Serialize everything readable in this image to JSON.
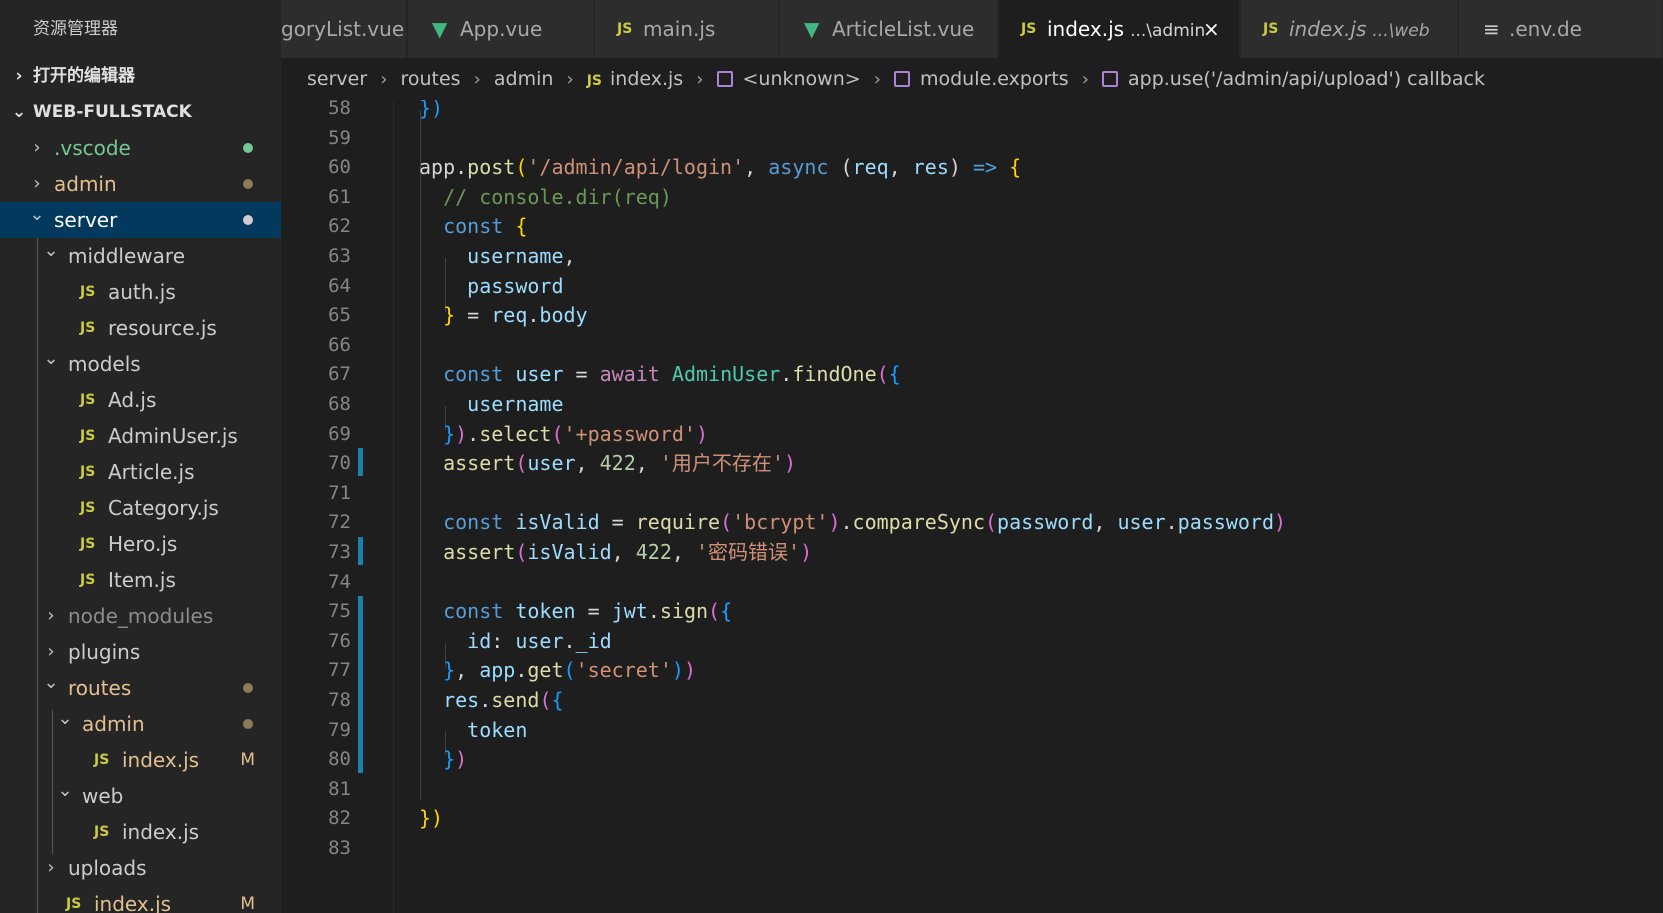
{
  "sidebar": {
    "title": "资源管理器",
    "sections": {
      "open_editors": "打开的编辑器",
      "project": "WEB-FULLSTACK"
    },
    "tree": [
      {
        "label": ".vscode",
        "color": "#73c991",
        "dot": "#73c991",
        "kind": "folder",
        "expanded": false
      },
      {
        "label": "admin",
        "color": "#e2c08d",
        "dot": "#8f7a57",
        "kind": "folder",
        "expanded": false
      },
      {
        "label": "server",
        "color": "#ffffff",
        "dot": "#cfcfcf",
        "kind": "folder",
        "expanded": true,
        "selected": true
      },
      {
        "label": "middleware",
        "color": "#cccccc",
        "kind": "folder",
        "expanded": true
      },
      {
        "label": "auth.js",
        "color": "#cccccc",
        "kind": "js"
      },
      {
        "label": "resource.js",
        "color": "#cccccc",
        "kind": "js"
      },
      {
        "label": "models",
        "color": "#cccccc",
        "kind": "folder",
        "expanded": true
      },
      {
        "label": "Ad.js",
        "color": "#cccccc",
        "kind": "js"
      },
      {
        "label": "AdminUser.js",
        "color": "#cccccc",
        "kind": "js"
      },
      {
        "label": "Article.js",
        "color": "#cccccc",
        "kind": "js"
      },
      {
        "label": "Category.js",
        "color": "#cccccc",
        "kind": "js"
      },
      {
        "label": "Hero.js",
        "color": "#cccccc",
        "kind": "js"
      },
      {
        "label": "Item.js",
        "color": "#cccccc",
        "kind": "js"
      },
      {
        "label": "node_modules",
        "color": "#8c8c8c",
        "kind": "folder",
        "expanded": false
      },
      {
        "label": "plugins",
        "color": "#cccccc",
        "kind": "folder",
        "expanded": false
      },
      {
        "label": "routes",
        "color": "#e2c08d",
        "dot": "#8f7a57",
        "kind": "folder",
        "expanded": true
      },
      {
        "label": "admin",
        "color": "#e2c08d",
        "dot": "#8f7a57",
        "kind": "folder",
        "expanded": true
      },
      {
        "label": "index.js",
        "color": "#e2c08d",
        "badge": "M",
        "kind": "js"
      },
      {
        "label": "web",
        "color": "#cccccc",
        "kind": "folder",
        "expanded": true
      },
      {
        "label": "index.js",
        "color": "#cccccc",
        "kind": "js"
      },
      {
        "label": "uploads",
        "color": "#cccccc",
        "kind": "folder",
        "expanded": false
      },
      {
        "label": "index.js",
        "color": "#e2c08d",
        "badge": "M",
        "kind": "js"
      }
    ]
  },
  "tabs": [
    {
      "label": "goryList.vue",
      "icon": "none"
    },
    {
      "label": "App.vue",
      "icon": "vue"
    },
    {
      "label": "main.js",
      "icon": "js"
    },
    {
      "label": "ArticleList.vue",
      "icon": "vue"
    },
    {
      "label": "index.js",
      "desc": "...\\admin",
      "icon": "js",
      "active": true,
      "close": "×"
    },
    {
      "label": "index.js",
      "desc": "...\\web",
      "icon": "js",
      "italic": true
    },
    {
      "label": ".env.de",
      "icon": "lines"
    }
  ],
  "icons": {
    "js": "JS",
    "chevron_right": "›",
    "chevron_down": "⌄"
  },
  "breadcrumb": [
    "server",
    "routes",
    "admin",
    "index.js",
    "<unknown>",
    "module.exports",
    "app.use('/admin/api/upload') callback"
  ],
  "editor": {
    "line_numbers": [
      "58",
      "59",
      "60",
      "61",
      "62",
      "63",
      "64",
      "65",
      "66",
      "67",
      "68",
      "69",
      "70",
      "71",
      "72",
      "73",
      "74",
      "75",
      "76",
      "77",
      "78",
      "79",
      "80",
      "81",
      "82",
      "83"
    ],
    "lines": [
      [
        [
          "})",
          "p3"
        ]
      ],
      [],
      [
        [
          "app",
          "plain"
        ],
        [
          ".",
          "plain"
        ],
        [
          "post",
          "fn"
        ],
        [
          "(",
          "p1"
        ],
        [
          "'/admin/api/login'",
          "str"
        ],
        [
          ", ",
          "plain"
        ],
        [
          "async",
          "kw"
        ],
        [
          " (",
          "plain"
        ],
        [
          "req",
          "var"
        ],
        [
          ", ",
          "plain"
        ],
        [
          "res",
          "var"
        ],
        [
          ") ",
          "plain"
        ],
        [
          "=>",
          "kw"
        ],
        [
          " {",
          "p1"
        ]
      ],
      [
        [
          "  // console.dir(req)",
          "com"
        ]
      ],
      [
        [
          "  const",
          "kw"
        ],
        [
          " {",
          "p1"
        ]
      ],
      [
        [
          "    username",
          "var"
        ],
        [
          ",",
          "plain"
        ]
      ],
      [
        [
          "    password",
          "var"
        ]
      ],
      [
        [
          "  }",
          "p1"
        ],
        [
          " = ",
          "plain"
        ],
        [
          "req",
          "var"
        ],
        [
          ".",
          "plain"
        ],
        [
          "body",
          "var"
        ]
      ],
      [],
      [
        [
          "  const",
          "kw"
        ],
        [
          " ",
          "plain"
        ],
        [
          "user",
          "var"
        ],
        [
          " = ",
          "plain"
        ],
        [
          "await",
          "ctl"
        ],
        [
          " ",
          "plain"
        ],
        [
          "AdminUser",
          "cls"
        ],
        [
          ".",
          "plain"
        ],
        [
          "findOne",
          "fn"
        ],
        [
          "(",
          "p2"
        ],
        [
          "{",
          "p3"
        ]
      ],
      [
        [
          "    username",
          "var"
        ]
      ],
      [
        [
          "  }",
          "p3"
        ],
        [
          ")",
          "p2"
        ],
        [
          ".",
          "plain"
        ],
        [
          "select",
          "fn"
        ],
        [
          "(",
          "p2"
        ],
        [
          "'+password'",
          "str"
        ],
        [
          ")",
          "p2"
        ]
      ],
      [
        [
          "  assert",
          "fn"
        ],
        [
          "(",
          "p2"
        ],
        [
          "user",
          "var"
        ],
        [
          ", ",
          "plain"
        ],
        [
          "422",
          "num"
        ],
        [
          ", ",
          "plain"
        ],
        [
          "'用户不存在'",
          "str"
        ],
        [
          ")",
          "p2"
        ]
      ],
      [],
      [
        [
          "  const",
          "kw"
        ],
        [
          " ",
          "plain"
        ],
        [
          "isValid",
          "var"
        ],
        [
          " = ",
          "plain"
        ],
        [
          "require",
          "fn"
        ],
        [
          "(",
          "p2"
        ],
        [
          "'bcrypt'",
          "str"
        ],
        [
          ")",
          "p2"
        ],
        [
          ".",
          "plain"
        ],
        [
          "compareSync",
          "fn"
        ],
        [
          "(",
          "p2"
        ],
        [
          "password",
          "var"
        ],
        [
          ", ",
          "plain"
        ],
        [
          "user",
          "var"
        ],
        [
          ".",
          "plain"
        ],
        [
          "password",
          "var"
        ],
        [
          ")",
          "p2"
        ]
      ],
      [
        [
          "  assert",
          "fn"
        ],
        [
          "(",
          "p2"
        ],
        [
          "isValid",
          "var"
        ],
        [
          ", ",
          "plain"
        ],
        [
          "422",
          "num"
        ],
        [
          ", ",
          "plain"
        ],
        [
          "'密码错误'",
          "str"
        ],
        [
          ")",
          "p2"
        ]
      ],
      [],
      [
        [
          "  const",
          "kw"
        ],
        [
          " ",
          "plain"
        ],
        [
          "token",
          "var"
        ],
        [
          " = ",
          "plain"
        ],
        [
          "jwt",
          "var"
        ],
        [
          ".",
          "plain"
        ],
        [
          "sign",
          "fn"
        ],
        [
          "(",
          "p2"
        ],
        [
          "{",
          "p3"
        ]
      ],
      [
        [
          "    id",
          "var"
        ],
        [
          ": ",
          "plain"
        ],
        [
          "user",
          "var"
        ],
        [
          ".",
          "plain"
        ],
        [
          "_id",
          "var"
        ]
      ],
      [
        [
          "  }",
          "p3"
        ],
        [
          ", ",
          "plain"
        ],
        [
          "app",
          "var"
        ],
        [
          ".",
          "plain"
        ],
        [
          "get",
          "fn"
        ],
        [
          "(",
          "p3"
        ],
        [
          "'secret'",
          "str"
        ],
        [
          ")",
          "p3"
        ],
        [
          ")",
          "p2"
        ]
      ],
      [
        [
          "  res",
          "var"
        ],
        [
          ".",
          "plain"
        ],
        [
          "send",
          "fn"
        ],
        [
          "(",
          "p2"
        ],
        [
          "{",
          "p3"
        ]
      ],
      [
        [
          "    token",
          "var"
        ]
      ],
      [
        [
          "  }",
          "p3"
        ],
        [
          ")",
          "p2"
        ]
      ],
      [],
      [
        [
          "})",
          "p1"
        ]
      ],
      []
    ]
  }
}
